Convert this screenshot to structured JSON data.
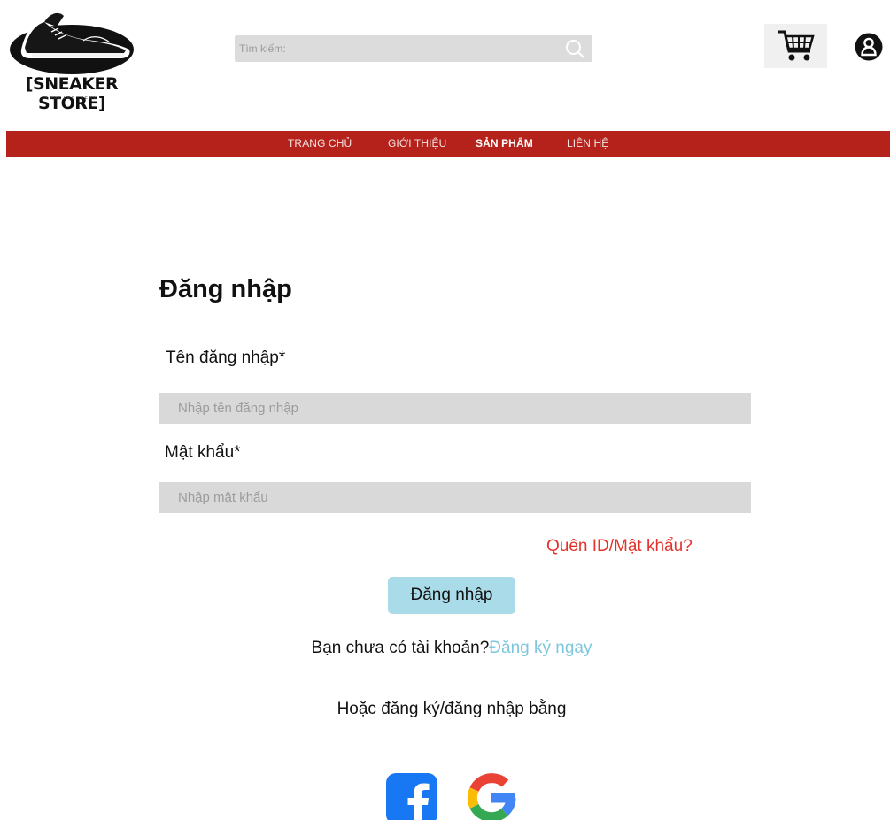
{
  "header": {
    "logo_text": "[SNEAKER STORE]",
    "logo_tagline": "TAGLINE HERE",
    "search_placeholder": "Tìm kiếm:"
  },
  "nav": {
    "items": [
      "TRANG CHỦ",
      "GIỚI THIỆU",
      "SẢN PHẨM",
      "LIÊN HỆ"
    ],
    "active": "SẢN PHẨM"
  },
  "form": {
    "title": "Đăng nhập",
    "username_label": "Tên đăng nhập*",
    "username_placeholder": "Nhập tên đăng nhập",
    "password_label": "Mật khẩu*",
    "password_placeholder": "Nhập mật khẩu",
    "forgot_link": "Quên ID/Mật khẩu?",
    "submit_label": "Đăng nhập",
    "no_account_text": "Bạn chưa có tài khoản?",
    "register_link": "Đăng ký ngay",
    "social_text": "Hoặc đăng ký/đăng nhập bằng"
  },
  "icons": [
    "sneaker-logo",
    "search-icon",
    "shopping-cart-icon",
    "user-icon",
    "facebook-icon",
    "google-icon"
  ],
  "colors": {
    "nav_bar": "#b5221b",
    "forgot_link": "#e4322b",
    "register_link": "#7cc6de",
    "submit_button": "#a9dbe9",
    "input_background": "#d9d9d9",
    "facebook": "#1877f2"
  }
}
